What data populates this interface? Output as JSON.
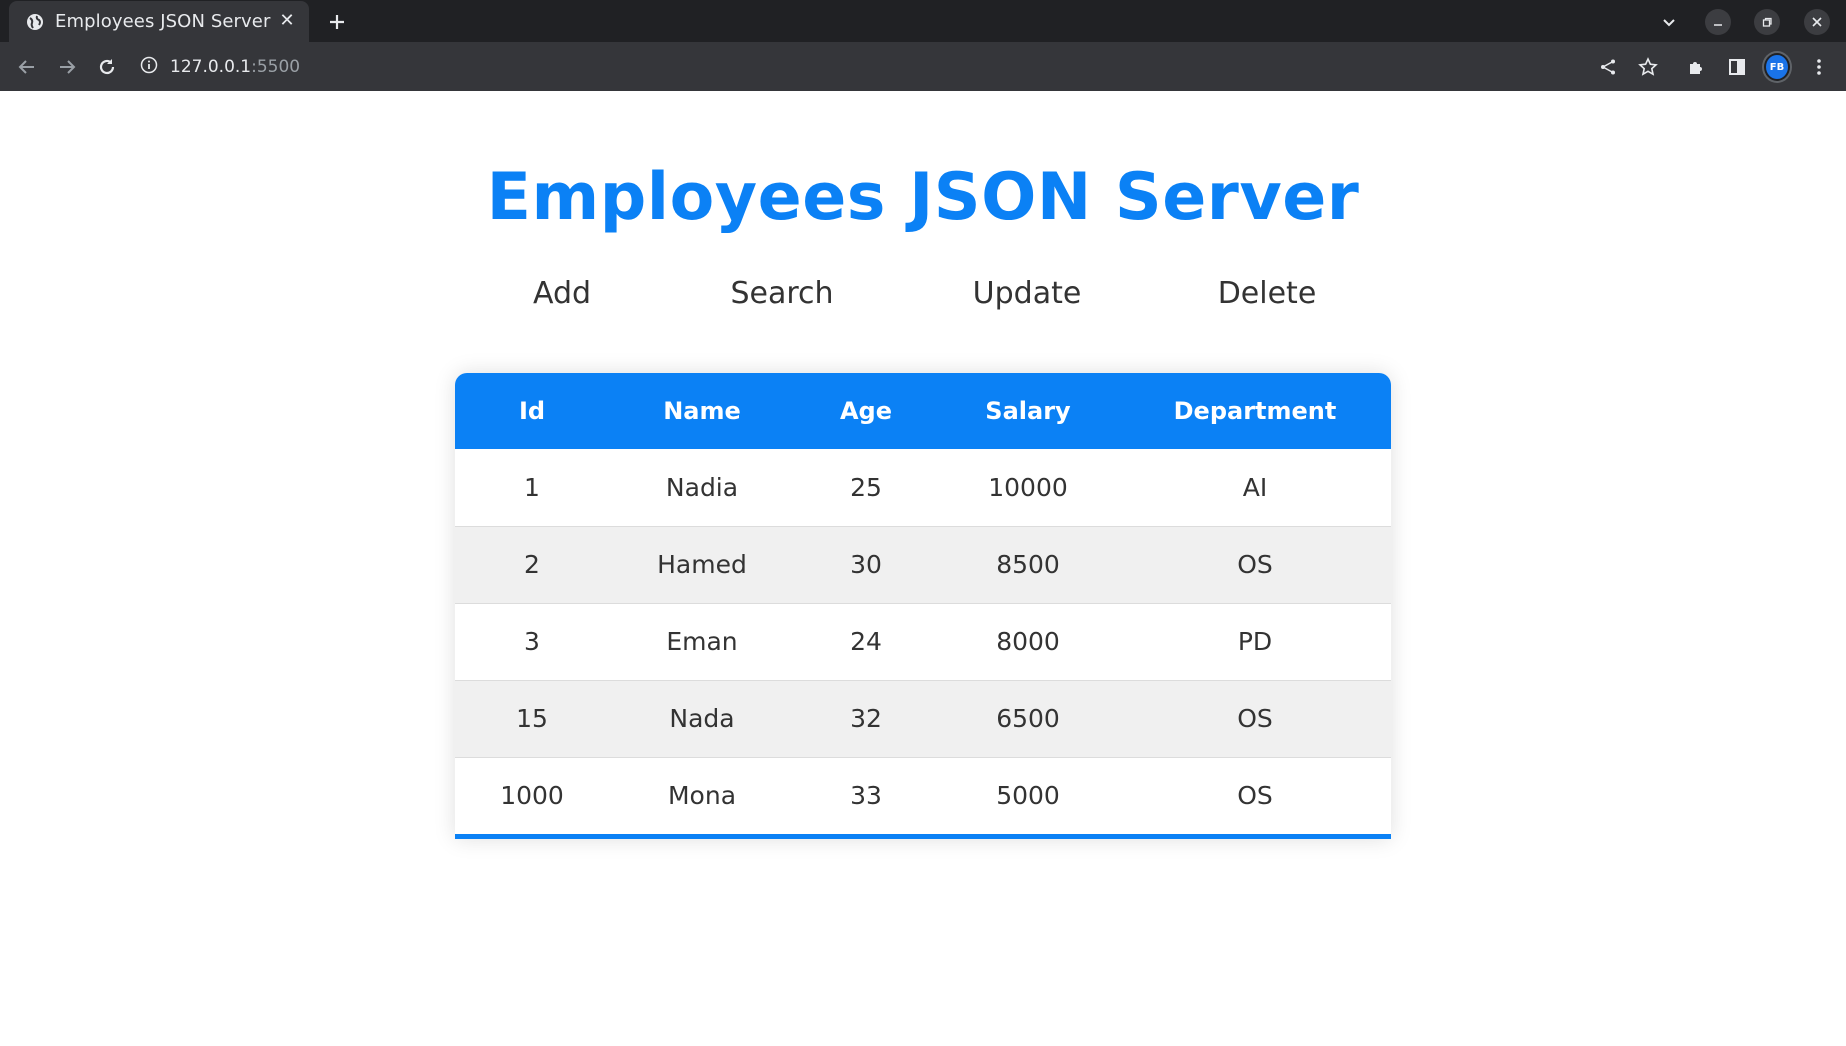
{
  "browser": {
    "tab_title": "Employees JSON Server",
    "url_host": "127.0.0.1",
    "url_port": ":5500",
    "profile_initials": "FB"
  },
  "page": {
    "title": "Employees JSON Server",
    "actions": [
      "Add",
      "Search",
      "Update",
      "Delete"
    ]
  },
  "table": {
    "headers": [
      "Id",
      "Name",
      "Age",
      "Salary",
      "Department"
    ],
    "rows": [
      [
        "1",
        "Nadia",
        "25",
        "10000",
        "AI"
      ],
      [
        "2",
        "Hamed",
        "30",
        "8500",
        "OS"
      ],
      [
        "3",
        "Eman",
        "24",
        "8000",
        "PD"
      ],
      [
        "15",
        "Nada",
        "32",
        "6500",
        "OS"
      ],
      [
        "1000",
        "Mona",
        "33",
        "5000",
        "OS"
      ]
    ]
  },
  "colors": {
    "accent": "#0b81f5",
    "chrome_dark": "#202124",
    "chrome_toolbar": "#35363a",
    "row_alt": "#f0f0f0"
  }
}
